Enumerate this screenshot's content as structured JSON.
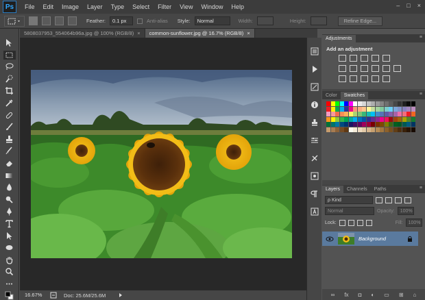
{
  "app": {
    "logo": "Ps",
    "window_controls": [
      "–",
      "□",
      "×"
    ]
  },
  "menu": [
    "File",
    "Edit",
    "Image",
    "Layer",
    "Type",
    "Select",
    "Filter",
    "View",
    "Window",
    "Help"
  ],
  "options": {
    "feather_label": "Feather:",
    "feather_value": "0.1 px",
    "antialias_label": "Anti-alias",
    "style_label": "Style:",
    "style_value": "Normal",
    "width_label": "Width:",
    "height_label": "Height:",
    "refine_edge_label": "Refine Edge..."
  },
  "documents": {
    "tabs": [
      {
        "label": "5808037953_554064b96a.jpg @ 100% (RGB/8)",
        "close": "×"
      },
      {
        "label": "common-sunflower.jpg @ 16.7% (RGB/8)",
        "close": "×"
      }
    ],
    "active_index": 1
  },
  "status": {
    "zoom": "16.67%",
    "doc_size": "Doc: 25.6M/25.6M"
  },
  "panels": {
    "adjustments": {
      "tab": "Adjustments",
      "title": "Add an adjustment"
    },
    "color_tabs": [
      "Color",
      "Swatches"
    ],
    "layers": {
      "tabs": [
        "Layers",
        "Channels",
        "Paths"
      ],
      "kind_label": "Kind",
      "blend_mode": "Normal",
      "opacity_label": "Opacity:",
      "opacity_value": "100%",
      "lock_label": "Lock:",
      "fill_label": "Fill:",
      "fill_value": "100%",
      "items": [
        {
          "name": "Background",
          "locked": true,
          "visible": true
        }
      ]
    }
  },
  "colors": {
    "menu_bg": "#3c3c3c",
    "panel_bg": "#535353",
    "canvas_bg": "#282828",
    "selection": "#5a7a9e"
  },
  "swatches": [
    "#ff0000",
    "#ffff00",
    "#00ff00",
    "#00ffff",
    "#0000ff",
    "#ff00ff",
    "#ffffff",
    "#ebebeb",
    "#d6d6d6",
    "#c2c2c2",
    "#adadad",
    "#999999",
    "#858585",
    "#707070",
    "#5c5c5c",
    "#474747",
    "#333333",
    "#1f1f1f",
    "#0a0a0a",
    "#000000",
    "#ee1d24",
    "#fff100",
    "#00a650",
    "#00aeef",
    "#2f3192",
    "#ed008c",
    "#f7977a",
    "#fbad82",
    "#fdc68c",
    "#fff799",
    "#c6df9c",
    "#a4d49d",
    "#81ca9d",
    "#7bcdc9",
    "#6ccff7",
    "#7ca6d8",
    "#8293ca",
    "#8881be",
    "#a286bd",
    "#bc8cbf",
    "#f49bc1",
    "#f5999d",
    "#f16c4d",
    "#f68e56",
    "#fbaf5a",
    "#fff467",
    "#acd372",
    "#7dc473",
    "#39b778",
    "#16bcb4",
    "#00bff3",
    "#438ccb",
    "#5573b7",
    "#5e5ca7",
    "#855fa8",
    "#a763a9",
    "#ef6ea8",
    "#f16d7e",
    "#ee1d24",
    "#f16522",
    "#f7941d",
    "#fff100",
    "#8fc63d",
    "#37b44a",
    "#00a650",
    "#00a99e",
    "#00aeef",
    "#0072bc",
    "#0054a5",
    "#2f3192",
    "#652c91",
    "#91278f",
    "#ed008c",
    "#ee105a",
    "#9d0a0f",
    "#a1410d",
    "#a36209",
    "#aba000",
    "#588528",
    "#197b30",
    "#007236",
    "#00736a",
    "#0076a4",
    "#004a80",
    "#003370",
    "#1d1363",
    "#450e61",
    "#62055f",
    "#9e005c",
    "#9d0039",
    "#790000",
    "#7b3000",
    "#7c4900",
    "#827a00",
    "#3e6617",
    "#045f20",
    "#005824",
    "#005951",
    "#005b7e",
    "#003562",
    "#c69c6d",
    "#a67c52",
    "#8c6239",
    "#754c24",
    "#603913",
    "#fdfbf0",
    "#f5ebd8",
    "#eedbc1",
    "#e3caa8",
    "#d5b48c",
    "#c6a070",
    "#b58b56",
    "#a1763f",
    "#8c612c",
    "#774f1f",
    "#613e16",
    "#4c2e0f",
    "#3a2109",
    "#281505",
    "#180b02"
  ]
}
